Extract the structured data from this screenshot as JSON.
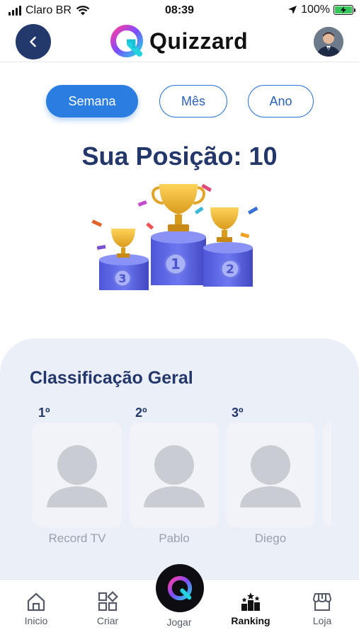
{
  "status_bar": {
    "carrier": "Claro BR",
    "time": "08:39",
    "battery": "100%"
  },
  "header": {
    "app_name": "Quizzard"
  },
  "filters": [
    {
      "label": "Semana",
      "active": true
    },
    {
      "label": "Mês",
      "active": false
    },
    {
      "label": "Ano",
      "active": false
    }
  ],
  "position": {
    "title": "Sua Posição: 10"
  },
  "ranking": {
    "title": "Classificação Geral",
    "entries": [
      {
        "rank": "1º",
        "name": "Record TV"
      },
      {
        "rank": "2º",
        "name": "Pablo"
      },
      {
        "rank": "3º",
        "name": "Diego"
      }
    ]
  },
  "nav": {
    "items": [
      {
        "label": "Inicio",
        "icon": "home-icon"
      },
      {
        "label": "Criar",
        "icon": "grid-add-icon"
      },
      {
        "label": "Jogar",
        "icon": "quizzard-logo-icon"
      },
      {
        "label": "Ranking",
        "icon": "ranking-icon"
      },
      {
        "label": "Loja",
        "icon": "store-icon"
      }
    ]
  },
  "colors": {
    "primary": "#2a7de1",
    "navy": "#23376b",
    "panel_bg": "#ebeff7"
  }
}
